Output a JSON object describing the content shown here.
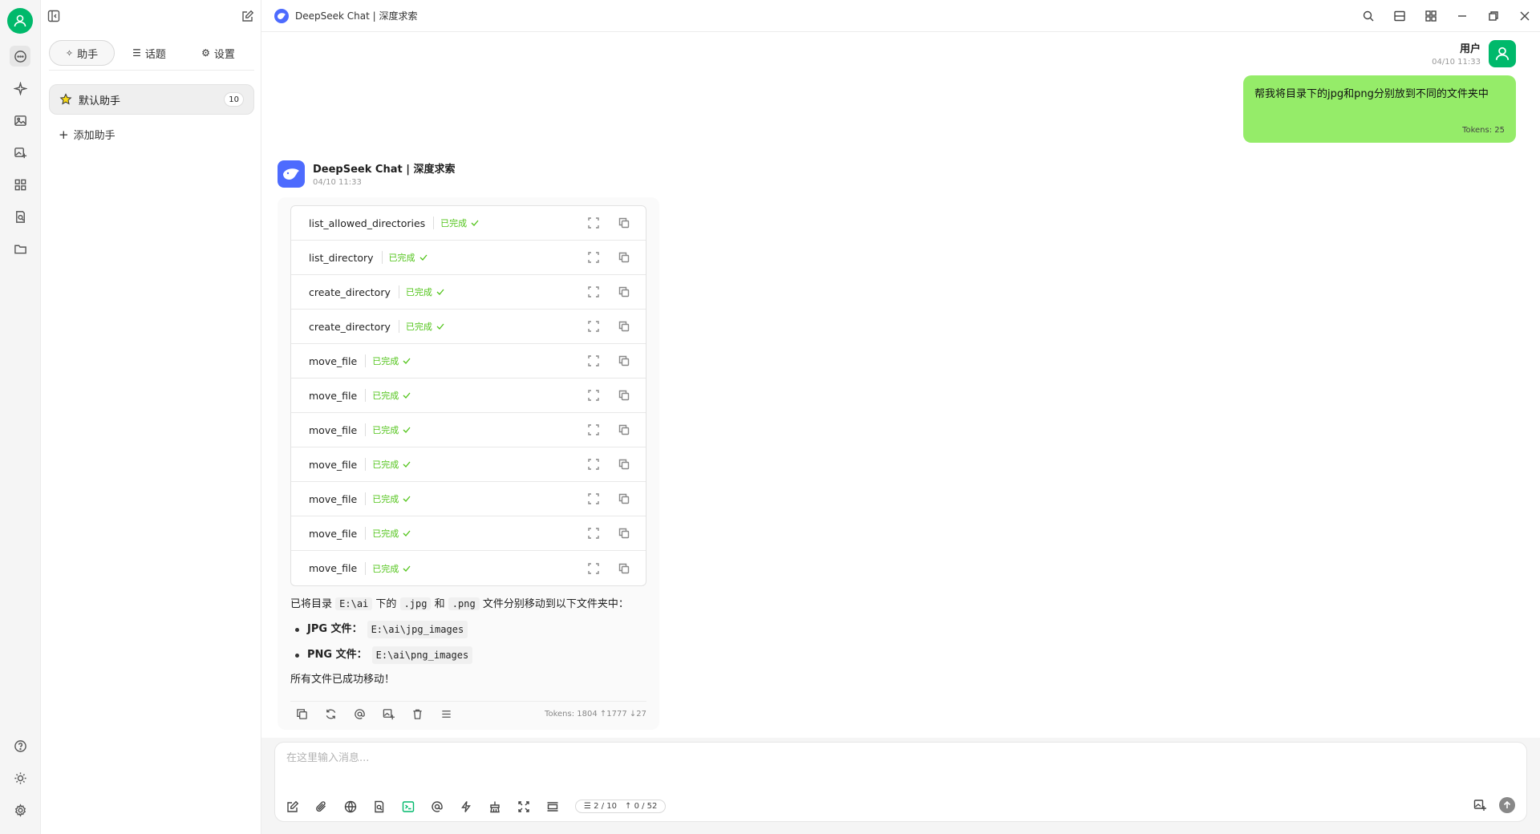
{
  "window": {
    "title": "DeepSeek Chat | 深度求索"
  },
  "sidebar": {
    "tabs": [
      {
        "label": "助手",
        "icon": "sparkle-icon",
        "active": true
      },
      {
        "label": "话题",
        "icon": "list-icon",
        "active": false
      },
      {
        "label": "设置",
        "icon": "gear-icon",
        "active": false
      }
    ],
    "assistant": {
      "label": "默认助手",
      "count": "10"
    },
    "add_assistant": "添加助手"
  },
  "chat": {
    "user": {
      "name": "用户",
      "time": "04/10 11:33",
      "message": "帮我将目录下的jpg和png分别放到不同的文件夹中",
      "tokens": "Tokens: 25"
    },
    "bot": {
      "name": "DeepSeek Chat | 深度求索",
      "time": "04/10 11:33",
      "status_label": "已完成",
      "tools": [
        "list_allowed_directories",
        "list_directory",
        "create_directory",
        "create_directory",
        "move_file",
        "move_file",
        "move_file",
        "move_file",
        "move_file",
        "move_file",
        "move_file"
      ],
      "answer": {
        "p1_a": "已将目录",
        "p1_dir": "E:\\ai",
        "p1_b": "下的",
        "p1_jpg": ".jpg",
        "p1_c": "和",
        "p1_png": ".png",
        "p1_d": "文件分别移动到以下文件夹中：",
        "jpg_label": "JPG 文件",
        "jpg_path": "E:\\ai\\jpg_images",
        "png_label": "PNG 文件",
        "png_path": "E:\\ai\\png_images",
        "colon": "：",
        "closing": "所有文件已成功移动！"
      },
      "tokens": "Tokens: 1804 ↑1777 ↓27"
    }
  },
  "composer": {
    "placeholder": "在这里输入消息...",
    "context_count": "2 / 10",
    "token_count": "0 / 52"
  },
  "colors": {
    "accent": "#00b96b",
    "user_bubble": "#95ec69",
    "deepseek_blue": "#4d6bfe",
    "done_green": "#52c41a"
  }
}
